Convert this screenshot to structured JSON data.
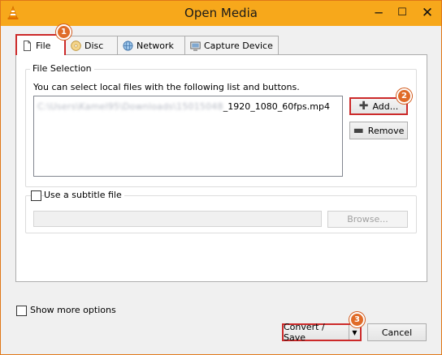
{
  "window": {
    "title": "Open Media",
    "minimize_glyph": "─",
    "maximize_glyph": "☐",
    "close_glyph": "✕"
  },
  "tabs": [
    {
      "label": "File",
      "icon": "file-icon",
      "active": true
    },
    {
      "label": "Disc",
      "icon": "disc-icon",
      "active": false
    },
    {
      "label": "Network",
      "icon": "network-icon",
      "active": false
    },
    {
      "label": "Capture Device",
      "icon": "capture-device-icon",
      "active": false
    }
  ],
  "file_selection": {
    "group_label": "File Selection",
    "hint": "You can select local files with the following list and buttons.",
    "file_path_obscured": "C:\\Users\\Kamel95\\Downloads\\15015048",
    "file_name_visible": "_1920_1080_60fps.mp4",
    "add_label": "Add...",
    "remove_label": "Remove"
  },
  "subtitle": {
    "checkbox_label": "Use a subtitle file",
    "checked": false,
    "path_value": "",
    "browse_label": "Browse..."
  },
  "options": {
    "show_more_label": "Show more options",
    "checked": false
  },
  "footer": {
    "convert_label": "Convert / Save",
    "convert_arrow": "▼",
    "cancel_label": "Cancel"
  },
  "markers": [
    "1",
    "2",
    "3"
  ],
  "colors": {
    "titlebar": "#f7a81b",
    "highlight_border": "#cc2a2a",
    "marker": "#e06b28"
  }
}
